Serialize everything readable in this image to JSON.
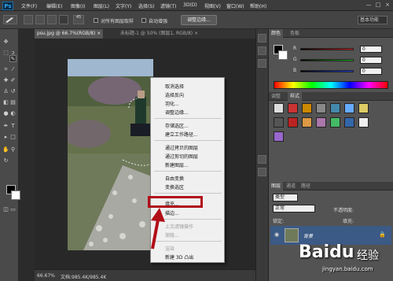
{
  "app": {
    "logo": "Ps",
    "menus": [
      "文件(F)",
      "编辑(E)",
      "图像(I)",
      "图层(L)",
      "文字(Y)",
      "选择(S)",
      "滤镜(T)",
      "3D(D)",
      "视图(V)",
      "窗口(W)",
      "帮助(H)"
    ],
    "window_controls": [
      "—",
      "□",
      "×"
    ]
  },
  "options": {
    "size": "45",
    "sample_all_label": "对所有图层取样",
    "enhance_label": "自动增强",
    "refine_label": "调整边缘...",
    "workspace": "基本功能"
  },
  "tabs": [
    {
      "label": "psu.jpg @ 66.7%(RGB/8)",
      "close": "×"
    },
    {
      "label": "未标题-1 @ 50% (图层1, RGB/8)",
      "close": "×"
    }
  ],
  "status": {
    "zoom": "66.67%",
    "doc": "文档:985.4K/985.4K"
  },
  "color_panel": {
    "tabs": [
      "颜色",
      "色板"
    ],
    "channels": [
      {
        "label": "R",
        "value": "0",
        "color": "#e02020"
      },
      {
        "label": "G",
        "value": "0",
        "color": "#20c020"
      },
      {
        "label": "B",
        "value": "0",
        "color": "#2040e0"
      }
    ]
  },
  "style_panel": {
    "tabs": [
      "调整",
      "样式"
    ]
  },
  "layers_panel": {
    "tabs": [
      "图层",
      "通道",
      "路径"
    ],
    "kind": "类型",
    "mode": "正常",
    "opacity_label": "不透明度:",
    "lock_label": "锁定:",
    "fill_label": "填充:",
    "layer_name": "背景"
  },
  "context_menu": {
    "items": [
      {
        "label": "取消选择",
        "disabled": false
      },
      {
        "label": "选择反向",
        "disabled": false
      },
      {
        "label": "羽化...",
        "disabled": false
      },
      {
        "label": "调整边缘...",
        "disabled": false
      },
      {
        "sep": true
      },
      {
        "label": "存储选区...",
        "disabled": false
      },
      {
        "label": "建立工作路径...",
        "disabled": false
      },
      {
        "sep": true
      },
      {
        "label": "通过拷贝的图层",
        "disabled": false
      },
      {
        "label": "通过剪切的图层",
        "disabled": false
      },
      {
        "label": "新建图层...",
        "disabled": false
      },
      {
        "sep": true
      },
      {
        "label": "自由变换",
        "disabled": false
      },
      {
        "label": "变换选区",
        "disabled": false
      },
      {
        "sep": true
      },
      {
        "label": "填充...",
        "disabled": false
      },
      {
        "label": "描边...",
        "disabled": false
      },
      {
        "sep": true
      },
      {
        "label": "上次滤镜操作",
        "disabled": true
      },
      {
        "label": "渐隐...",
        "disabled": true
      },
      {
        "sep": true
      },
      {
        "label": "渲染",
        "disabled": true
      },
      {
        "label": "新建 3D 凸出",
        "disabled": false
      }
    ]
  },
  "watermark": {
    "brand": "Baidu",
    "brand2": "经验",
    "url": "jingyan.baidu.com"
  },
  "colors": {
    "highlight": "#b10f18",
    "accent": "#1b6ea8"
  }
}
